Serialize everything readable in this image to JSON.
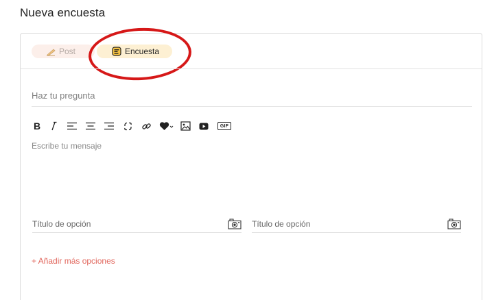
{
  "page": {
    "title": "Nueva encuesta"
  },
  "tabs": {
    "post_label": "Post",
    "survey_label": "Encuesta",
    "active": "Encuesta"
  },
  "question": {
    "placeholder": "Haz tu pregunta"
  },
  "toolbar": {
    "buttons": [
      "bold",
      "italic",
      "align-left",
      "align-center",
      "align-right",
      "unlink",
      "link",
      "heart-dropdown",
      "image",
      "video",
      "gif"
    ],
    "bold_label": "B",
    "italic_label": "I",
    "gif_label": "GIF"
  },
  "message": {
    "placeholder": "Escribe tu mensaje"
  },
  "options": [
    {
      "placeholder": "Título de opción"
    },
    {
      "placeholder": "Título de opción"
    }
  ],
  "add_options_label": "+ Añadir más opciones",
  "colors": {
    "annotation": "#d61818",
    "link": "#e1665c",
    "survey_tab_bg": "#fdf0d3",
    "post_tab_bg": "#fcefea"
  }
}
